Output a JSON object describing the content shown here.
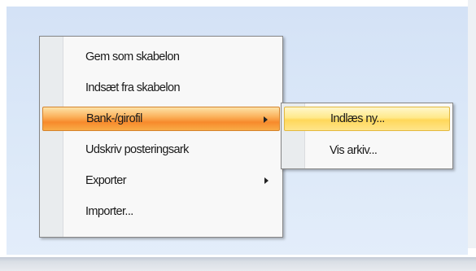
{
  "context_menu": {
    "items": [
      {
        "label": "Gem som skabelon",
        "has_submenu": false,
        "state": "normal"
      },
      {
        "label": "Indsæt fra skabelon",
        "has_submenu": false,
        "state": "normal"
      },
      {
        "label": "Bank-/girofil",
        "has_submenu": true,
        "state": "open"
      },
      {
        "label": "Udskriv posteringsark",
        "has_submenu": false,
        "state": "normal"
      },
      {
        "label": "Exporter",
        "has_submenu": true,
        "state": "normal"
      },
      {
        "label": "Importer...",
        "has_submenu": false,
        "state": "normal"
      }
    ]
  },
  "submenu": {
    "parent": "Bank-/girofil",
    "items": [
      {
        "label": "Indlæs ny...",
        "state": "highlighted"
      },
      {
        "label": "Vis arkiv...",
        "state": "normal"
      }
    ]
  },
  "icons": {
    "submenu_arrow": "chevron-right-icon"
  },
  "colors": {
    "background": "#d4e2f6",
    "menu_background": "#f8f8f8",
    "menu_gutter": "#e9ecee",
    "open_item_highlight": "#f78a2c",
    "hover_item_highlight": "#ffd75a"
  }
}
